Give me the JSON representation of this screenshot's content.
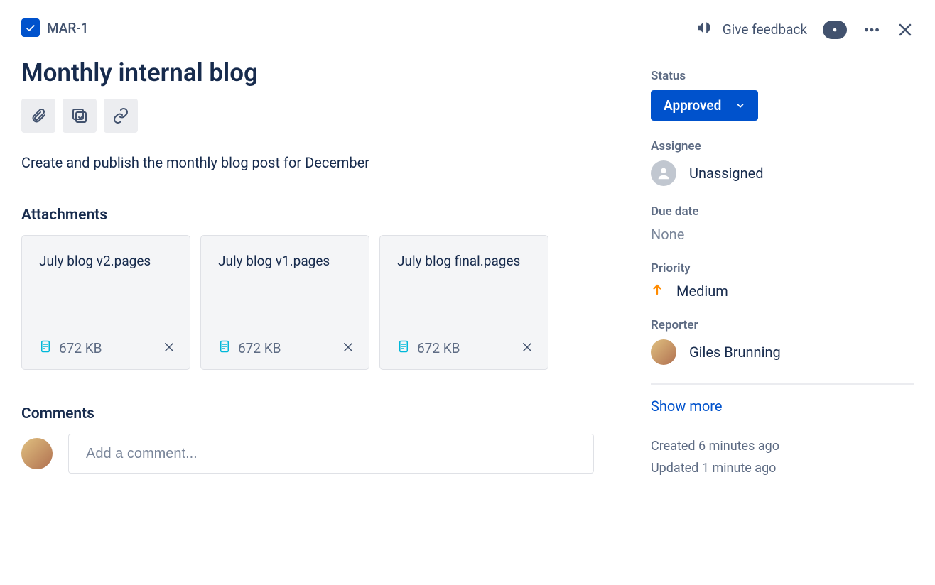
{
  "header": {
    "issue_key": "MAR-1",
    "feedback_label": "Give feedback"
  },
  "issue": {
    "title": "Monthly internal blog",
    "description": "Create and publish the monthly blog post for December"
  },
  "attachments": {
    "heading": "Attachments",
    "items": [
      {
        "name": "July blog v2.pages",
        "size": "672 KB"
      },
      {
        "name": "July blog v1.pages",
        "size": "672 KB"
      },
      {
        "name": "July blog final.pages",
        "size": "672 KB"
      }
    ]
  },
  "comments": {
    "heading": "Comments",
    "placeholder": "Add a comment..."
  },
  "sidebar": {
    "status": {
      "label": "Status",
      "value": "Approved"
    },
    "assignee": {
      "label": "Assignee",
      "value": "Unassigned"
    },
    "due_date": {
      "label": "Due date",
      "value": "None"
    },
    "priority": {
      "label": "Priority",
      "value": "Medium"
    },
    "reporter": {
      "label": "Reporter",
      "value": "Giles Brunning"
    },
    "show_more": "Show more",
    "created": "Created 6 minutes ago",
    "updated": "Updated 1 minute ago"
  }
}
